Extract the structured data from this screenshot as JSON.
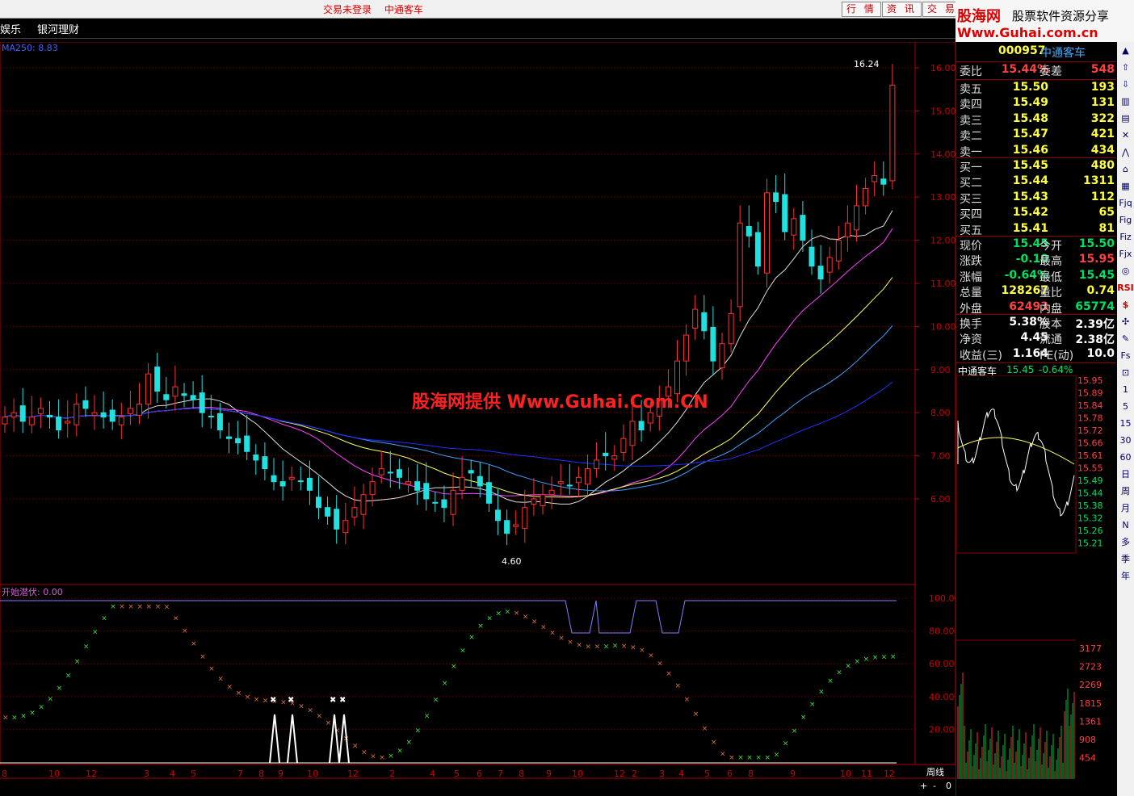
{
  "topbar": {
    "status": "交易未登录",
    "stock": "中通客车",
    "buttons": [
      "行 情",
      "资 讯",
      "交 易"
    ]
  },
  "menu": {
    "left": "娱乐",
    "item": "银河理财"
  },
  "logo": {
    "brand1": "股海网",
    "slogan": "股票软件资源分享",
    "url": "Www.Guhai.com.cn"
  },
  "main_indicator": {
    "label": "MA250: 8.83"
  },
  "sub_indicator": {
    "label": "开始潜伏: 0.00"
  },
  "watermark": "股海网提供 Www.Guhai.Com.CN",
  "annotations": {
    "high": "16.24",
    "low": "4.60"
  },
  "price_axis": [
    "16.00",
    "15.00",
    "14.00",
    "13.00",
    "12.00",
    "11.00",
    "10.00",
    "9.00",
    "8.00",
    "7.00",
    "6.00"
  ],
  "sub_axis": [
    "100.00",
    "80.00",
    "60.00",
    "40.00",
    "20.00"
  ],
  "x_axis": [
    "8",
    "10",
    "12",
    "3",
    "4",
    "5",
    "7",
    "8",
    "9",
    "10",
    "12",
    "2",
    "4",
    "5",
    "6",
    "7",
    "8",
    "9",
    "10",
    "12",
    "2",
    "3",
    "4",
    "5",
    "6",
    "8",
    "9",
    "10",
    "11",
    "12"
  ],
  "period": "周线",
  "zoom": [
    "+",
    "-",
    "0"
  ],
  "quote": {
    "code": "000957",
    "name": "中通客车",
    "wb": {
      "label": "委比",
      "value": "15.44%",
      "label2": "委差",
      "value2": "548"
    },
    "sells": [
      {
        "label": "卖五",
        "price": "15.50",
        "vol": "193"
      },
      {
        "label": "卖四",
        "price": "15.49",
        "vol": "131"
      },
      {
        "label": "卖三",
        "price": "15.48",
        "vol": "322"
      },
      {
        "label": "卖二",
        "price": "15.47",
        "vol": "421"
      },
      {
        "label": "卖一",
        "price": "15.46",
        "vol": "434"
      }
    ],
    "buys": [
      {
        "label": "买一",
        "price": "15.45",
        "vol": "480"
      },
      {
        "label": "买二",
        "price": "15.44",
        "vol": "1311"
      },
      {
        "label": "买三",
        "price": "15.43",
        "vol": "112"
      },
      {
        "label": "买四",
        "price": "15.42",
        "vol": "65"
      },
      {
        "label": "买五",
        "price": "15.41",
        "vol": "81"
      }
    ],
    "stats": [
      {
        "a": "现价",
        "b": "15.45",
        "c": "今开",
        "d": "15.50",
        "bc": "g",
        "dc": "g"
      },
      {
        "a": "涨跌",
        "b": "-0.10",
        "c": "最高",
        "d": "15.95",
        "bc": "g",
        "dc": "r"
      },
      {
        "a": "涨幅",
        "b": "-0.64%",
        "c": "最低",
        "d": "15.45",
        "bc": "g",
        "dc": "g"
      },
      {
        "a": "总量",
        "b": "128267",
        "c": "量比",
        "d": "0.74",
        "bc": "y",
        "dc": "y"
      },
      {
        "a": "外盘",
        "b": "62493",
        "c": "内盘",
        "d": "65774",
        "bc": "r",
        "dc": "g"
      }
    ],
    "stats2": [
      {
        "a": "换手",
        "b": "5.38%",
        "c": "股本",
        "d": "2.39亿"
      },
      {
        "a": "净资",
        "b": "4.45",
        "c": "流通",
        "d": "2.38亿"
      },
      {
        "a": "收益(三)",
        "b": "1.164",
        "c": "PE(动)",
        "d": "10.0"
      }
    ]
  },
  "minichart": {
    "title": "中通客车",
    "price": "15.45",
    "change": "-0.64%",
    "axis": [
      "15.95",
      "15.89",
      "15.84",
      "15.78",
      "15.72",
      "15.66",
      "15.61",
      "15.55",
      "15.49",
      "15.44",
      "15.38",
      "15.32",
      "15.26",
      "15.21"
    ],
    "vol_axis": [
      "3177",
      "2723",
      "2269",
      "1815",
      "1361",
      "908",
      "454"
    ]
  },
  "toolbar": [
    "▲",
    "⇧",
    "⇩",
    "▥",
    "▤",
    "✕",
    "⋀",
    "⌂",
    "▦",
    "Fjq",
    "Fig",
    "Fiz",
    "Fjx",
    "◎",
    "RSI",
    "$",
    "✣",
    "✎",
    "Fs",
    "⊡",
    "1",
    "5",
    "15",
    "30",
    "60",
    "日",
    "周",
    "月",
    "N",
    "多",
    "季",
    "年"
  ]
}
